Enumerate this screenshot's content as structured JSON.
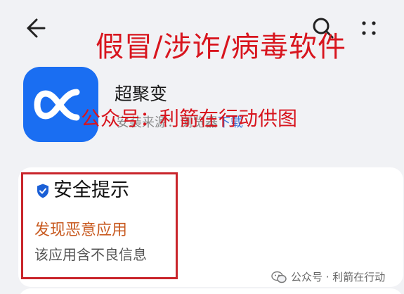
{
  "overlay": {
    "title": "假冒/涉诈/病毒软件",
    "credit": "公众号：利箭在行动供图"
  },
  "app": {
    "name": "超聚变",
    "source_prefix": "安装来源：浏览器",
    "source_suffix": "下载"
  },
  "security_card": {
    "title": "安全提示",
    "warning_title": "发现恶意应用",
    "warning_desc": "该应用含不良信息"
  },
  "watermark": {
    "text": "公众号 · 利箭在行动"
  },
  "colors": {
    "accent_red": "#d8151e",
    "app_blue": "#1a6ef2",
    "warning_orange": "#c85a20",
    "shield_blue": "#1a5fd6"
  }
}
